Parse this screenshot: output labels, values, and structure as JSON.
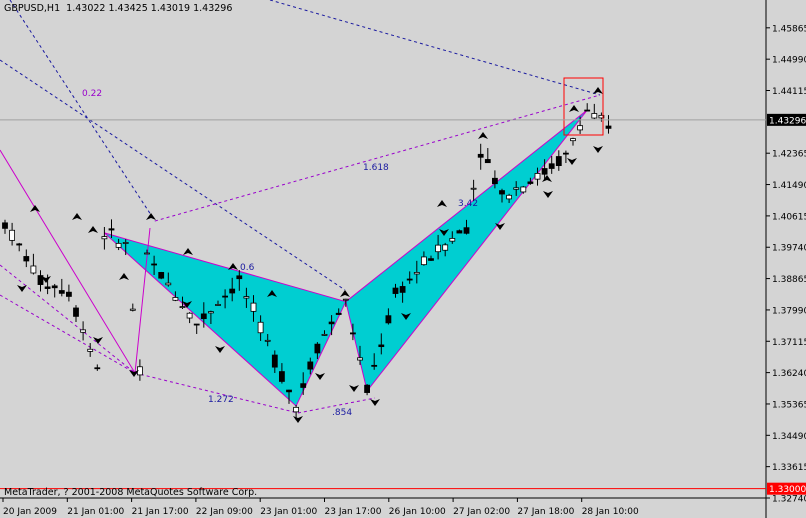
{
  "header": {
    "symbol": "GBPUSD,H1",
    "ohlc": "1.43022 1.43425 1.43019 1.43296"
  },
  "footer": {
    "copyright": "MetaTrader, ? 2001-2008 MetaQuotes Software Corp."
  },
  "colors": {
    "background": "#d4d4d4",
    "candle": "#000000",
    "pattern_fill": "#00ced1",
    "pattern_line": "#cc00cc",
    "fib_line": "#9900cc",
    "channel_line": "#1a1aa0",
    "fractal_arrow": "#000000",
    "highlight_box": "#ff0000",
    "current_price_line": "#a0a0a0",
    "price_tag_red": "#ff0000"
  },
  "chart_data": {
    "type": "candlestick",
    "title": "GBPUSD,H1",
    "y_ticks": [
      "1.45865",
      "1.44990",
      "1.44115",
      "1.43296",
      "1.42365",
      "1.41490",
      "1.40615",
      "1.39740",
      "1.38865",
      "1.37990",
      "1.37115",
      "1.36240",
      "1.35365",
      "1.34490",
      "1.33615",
      "1.32740"
    ],
    "ylim": [
      1.3274,
      1.4653
    ],
    "x_ticks": [
      "20 Jan 2009",
      "21 Jan 01:00",
      "21 Jan 17:00",
      "22 Jan 09:00",
      "23 Jan 01:00",
      "23 Jan 17:00",
      "26 Jan 10:00",
      "27 Jan 02:00",
      "27 Jan 18:00",
      "28 Jan 10:00"
    ],
    "current_price": {
      "label": "1.43296",
      "value": 1.43296
    },
    "red_price_line": {
      "label": "1.33000",
      "value": 1.33
    },
    "fib_labels": [
      "0.22",
      "1.618",
      "1.272",
      ".854",
      "3.42",
      "0.6"
    ],
    "harmonic_pattern": {
      "points": [
        {
          "bar": 14,
          "price": 1.4014
        },
        {
          "bar": 41,
          "price": 1.3531
        },
        {
          "bar": 48,
          "price": 1.3822
        },
        {
          "bar": 51,
          "price": 1.3573
        },
        {
          "bar": 82,
          "price": 1.4357
        }
      ]
    }
  }
}
